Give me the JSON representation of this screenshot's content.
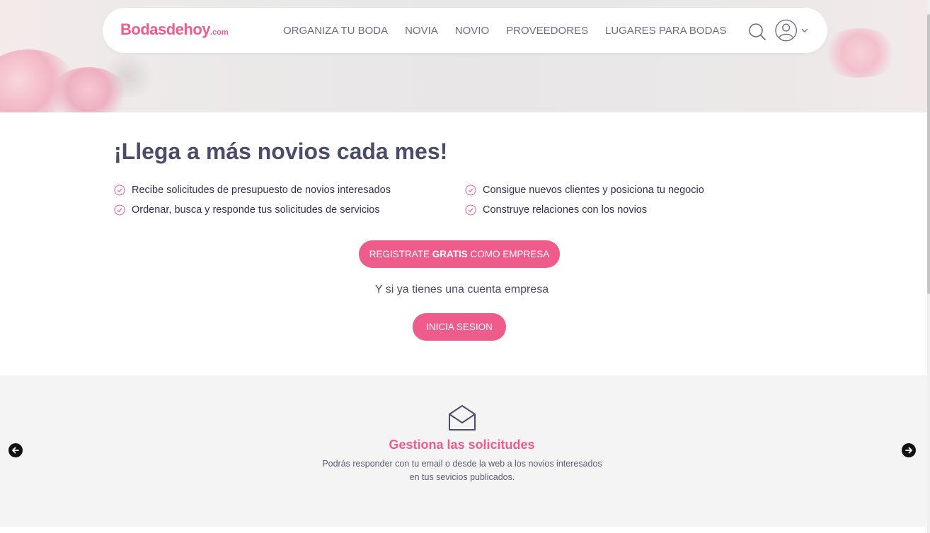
{
  "brand": {
    "logo_main": "Bodasdehoy",
    "logo_suffix": ".com",
    "accent_color": "#ef5b8b",
    "text_color": "#4a4c6a"
  },
  "nav": {
    "links": [
      "ORGANIZA TU BODA",
      "NOVIA",
      "NOVIO",
      "PROVEEDORES",
      "LUGARES PARA BODAS"
    ],
    "search_icon": "search-icon",
    "user_icon": "user-icon",
    "dropdown_icon": "chevron-down-icon"
  },
  "main": {
    "title": "¡Llega a más novios cada mes!",
    "benefits": [
      "Recibe solicitudes de presupuesto de novios interesados",
      "Consigue nuevos clientes y posiciona tu negocio",
      "Ordenar, busca y responde tus solicitudes de servicios",
      "Construye relaciones con los novios"
    ],
    "register_button": {
      "prefix": "REGISTRATE ",
      "bold": "GRATIS",
      "suffix": " COMO EMPRESA"
    },
    "subtext": "Y si ya tienes una cuenta empresa",
    "login_button": "INICIA SESION"
  },
  "carousel": {
    "icon": "envelope-open-icon",
    "title": "Gestiona las solicitudes",
    "description": "Podrás responder con tu email o desde la web a los novios interesados en tus sevicios publicados.",
    "prev_icon": "arrow-left-icon",
    "next_icon": "arrow-right-icon"
  }
}
